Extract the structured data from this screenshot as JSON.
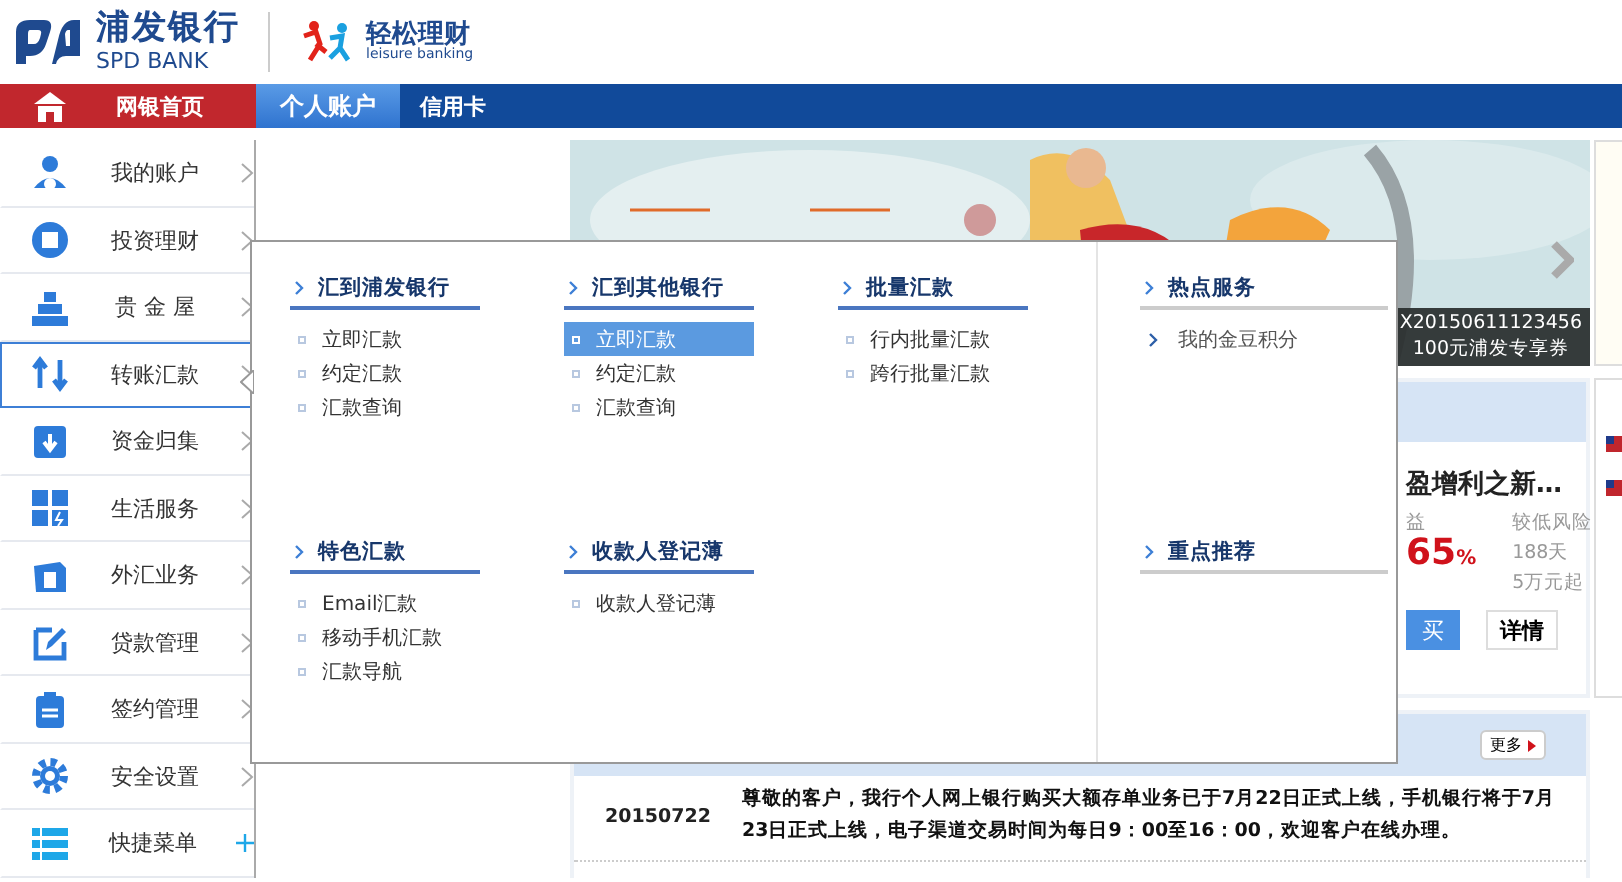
{
  "header": {
    "bank_name": "浦发银行",
    "bank_name_en": "SPD BANK",
    "brand": "轻松理财",
    "brand_en": "leisure banking"
  },
  "nav": {
    "home": "网银首页",
    "tabs": [
      {
        "label": "个人账户",
        "selected": true
      },
      {
        "label": "信用卡",
        "selected": false
      }
    ]
  },
  "sidebar": {
    "items": [
      {
        "label": "我的账户",
        "selected": false,
        "kind": "submenu"
      },
      {
        "label": "投资理财",
        "selected": false,
        "kind": "submenu"
      },
      {
        "label": "贵 金 屋",
        "selected": false,
        "kind": "submenu"
      },
      {
        "label": "转账汇款",
        "selected": true,
        "kind": "submenu"
      },
      {
        "label": "资金归集",
        "selected": false,
        "kind": "submenu"
      },
      {
        "label": "生活服务",
        "selected": false,
        "kind": "submenu"
      },
      {
        "label": "外汇业务",
        "selected": false,
        "kind": "submenu"
      },
      {
        "label": "贷款管理",
        "selected": false,
        "kind": "submenu"
      },
      {
        "label": "签约管理",
        "selected": false,
        "kind": "submenu"
      },
      {
        "label": "安全设置",
        "selected": false,
        "kind": "submenu"
      },
      {
        "label": "快捷菜单",
        "selected": false,
        "kind": "add"
      }
    ]
  },
  "banner": {
    "caption": [
      "X20150611123456",
      "100元浦发专享券"
    ]
  },
  "popup": {
    "groups": [
      {
        "heading": "汇到浦发银行",
        "items": [
          {
            "label": "立即汇款",
            "selected": false
          },
          {
            "label": "约定汇款",
            "selected": false
          },
          {
            "label": "汇款查询",
            "selected": false
          }
        ]
      },
      {
        "heading": "汇到其他银行",
        "items": [
          {
            "label": "立即汇款",
            "selected": true
          },
          {
            "label": "约定汇款",
            "selected": false
          },
          {
            "label": "汇款查询",
            "selected": false
          }
        ]
      },
      {
        "heading": "批量汇款",
        "items": [
          {
            "label": "行内批量汇款",
            "selected": false
          },
          {
            "label": "跨行批量汇款",
            "selected": false
          }
        ]
      },
      {
        "heading": "特色汇款",
        "items": [
          {
            "label": "Email汇款",
            "selected": false
          },
          {
            "label": "移动手机汇款",
            "selected": false
          },
          {
            "label": "汇款导航",
            "selected": false
          }
        ]
      },
      {
        "heading": "收款人登记薄",
        "items": [
          {
            "label": "收款人登记薄",
            "selected": false
          }
        ]
      }
    ],
    "side_groups": [
      {
        "heading": "热点服务",
        "items": [
          {
            "label": "我的金豆积分"
          }
        ]
      },
      {
        "heading": "重点推荐"
      }
    ]
  },
  "product": {
    "title": "盈增利之新…",
    "yield_label": "益",
    "rate": "65",
    "rate_unit": "%",
    "risk": "较低风险",
    "term": "188天",
    "minimum": "5万元起",
    "buy": "买",
    "details": "详情"
  },
  "notices": {
    "more": "更多",
    "items": [
      {
        "date": "20150722",
        "text": "尊敬的客户，我行个人网上银行购买大额存单业务已于7月22日正式上线，手机银行将于7月23日正式上线，电子渠道交易时间为每日9：00至16：00，欢迎客户在线办理。"
      }
    ]
  }
}
